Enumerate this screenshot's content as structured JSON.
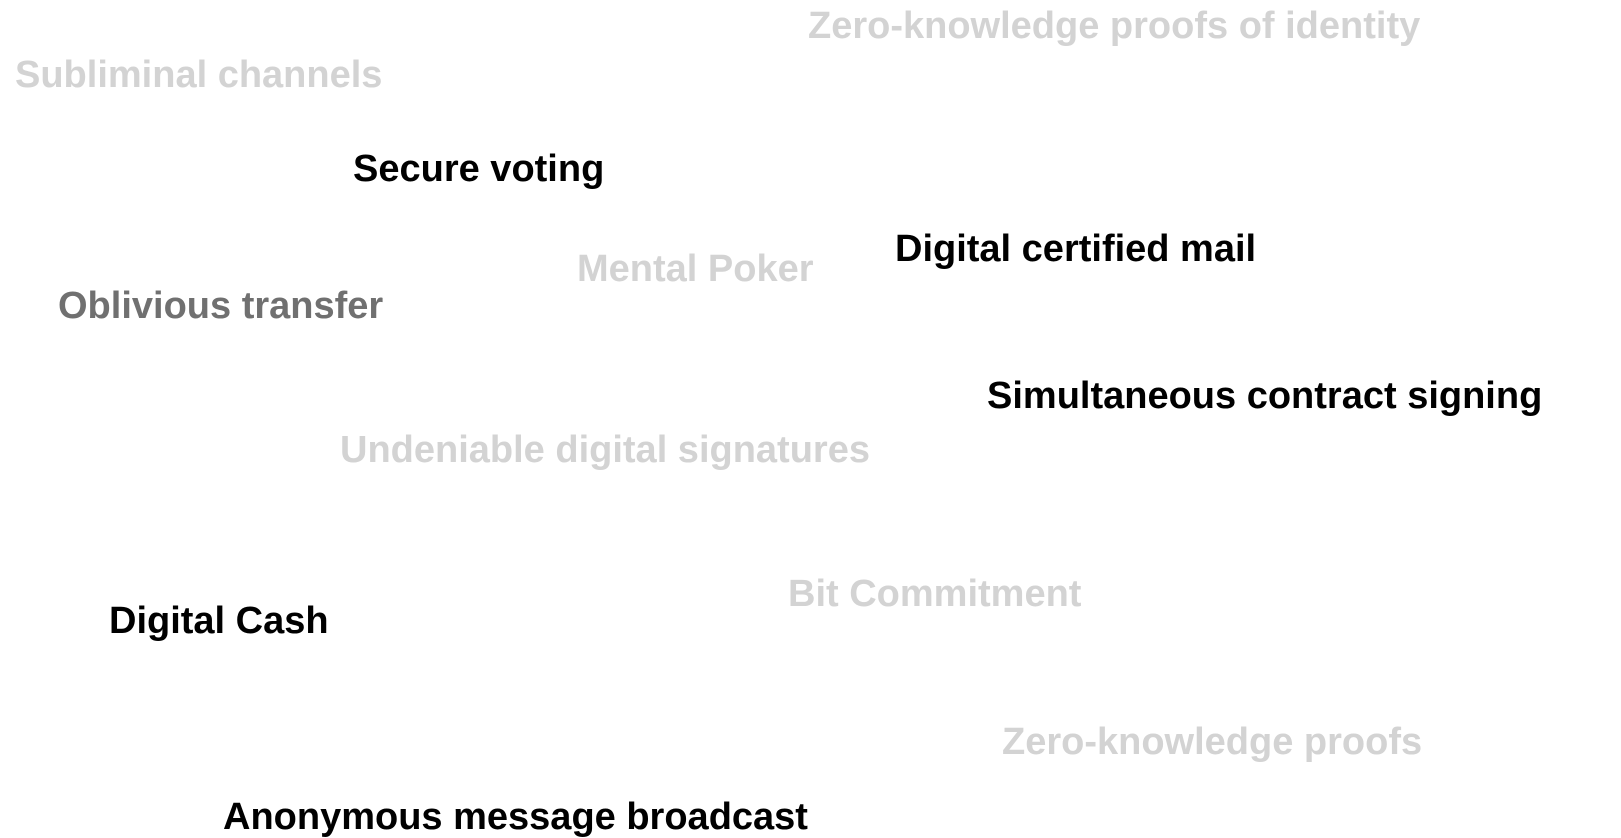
{
  "colors": {
    "dark": "#000000",
    "medium": "#707070",
    "light": "#d3d3d3",
    "background": "#ffffff"
  },
  "terms": {
    "zkp_identity": {
      "label": "Zero-knowledge proofs of identity",
      "shade": "light"
    },
    "subliminal": {
      "label": "Subliminal channels",
      "shade": "light"
    },
    "voting": {
      "label": "Secure voting",
      "shade": "dark"
    },
    "certified_mail": {
      "label": "Digital certified mail",
      "shade": "dark"
    },
    "poker": {
      "label": "Mental Poker",
      "shade": "light"
    },
    "oblivious": {
      "label": "Oblivious transfer",
      "shade": "medium"
    },
    "contract": {
      "label": "Simultaneous contract signing",
      "shade": "dark"
    },
    "undeniable": {
      "label": "Undeniable digital signatures",
      "shade": "light"
    },
    "bit_commitment": {
      "label": "Bit Commitment",
      "shade": "light"
    },
    "cash": {
      "label": "Digital Cash",
      "shade": "dark"
    },
    "zkp": {
      "label": "Zero-knowledge proofs",
      "shade": "light"
    },
    "anonymous": {
      "label": "Anonymous message broadcast",
      "shade": "dark"
    }
  }
}
